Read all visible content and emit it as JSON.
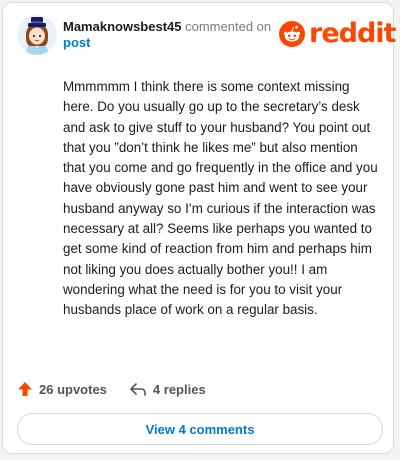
{
  "comment": {
    "username": "Mamaknowsbest45",
    "commented_on": "commented on",
    "post_label": "post",
    "body": "Mmmmmm I think there is some context missing here. Do you usually go up to the secretary’s desk and ask to give stuff to your husband? You point out that you ”don’t think he likes me” but also mention that you come and go frequently in the office and you have obviously gone past him and went to see your husband anyway so I’m curious if the interaction was necessary at all? Seems like perhaps you wanted to get some kind of reaction from him and perhaps him not liking you does actually bother you!! I am wondering what the need is for you to visit your husbands place of work on a regular basis."
  },
  "brand": {
    "name": "reddit",
    "color": "#ff4500"
  },
  "actions": {
    "upvotes": "26 upvotes",
    "replies": "4 replies"
  },
  "view_comments": "View 4 comments",
  "icons": {
    "avatar": "avatar",
    "logo": "reddit-logo-icon",
    "upvote": "upvote-arrow-icon",
    "reply": "reply-arrow-icon"
  },
  "colors": {
    "link": "#0079d3",
    "upvote": "#ff4500",
    "text": "#1c1c1c",
    "muted": "#7c7c7c"
  }
}
